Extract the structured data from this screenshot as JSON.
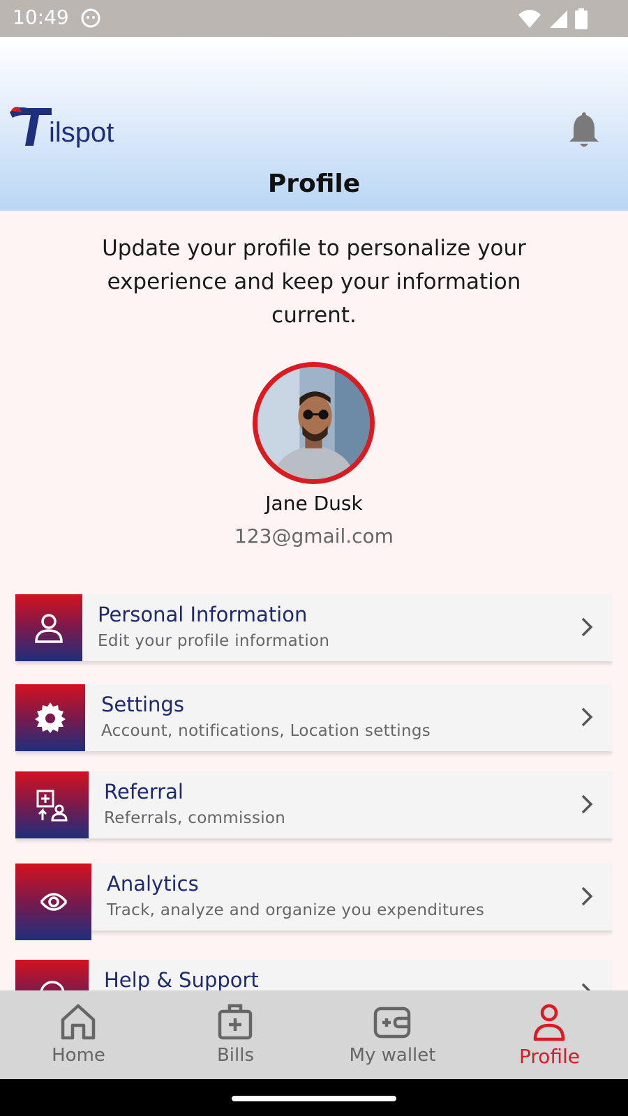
{
  "status_bar": {
    "time": "10:49"
  },
  "header": {
    "brand": "Tilspot",
    "title": "Profile"
  },
  "intro_text": "Update your profile to personalize your experience and keep your information current.",
  "user": {
    "name": "Jane Dusk",
    "email": "123@gmail.com"
  },
  "menu": [
    {
      "title": "Personal Information",
      "subtitle": "Edit your profile information",
      "icon": "user-icon"
    },
    {
      "title": "Settings",
      "subtitle": "Account, notifications, Location settings",
      "icon": "gear-icon"
    },
    {
      "title": "Referral",
      "subtitle": "Referrals, commission",
      "icon": "referral-icon"
    },
    {
      "title": "Analytics",
      "subtitle": "Track, analyze and organize you expenditures",
      "icon": "eye-icon"
    },
    {
      "title": "Help & Support",
      "subtitle": "",
      "icon": "help-icon"
    }
  ],
  "bottom_nav": [
    {
      "label": "Home",
      "icon": "home-icon"
    },
    {
      "label": "Bills",
      "icon": "bills-icon"
    },
    {
      "label": "My wallet",
      "icon": "wallet-icon"
    },
    {
      "label": "Profile",
      "icon": "profile-icon",
      "active": true
    }
  ],
  "colors": {
    "accent_red": "#d91b22",
    "navy": "#1d2b6e",
    "header_blue": "#b9d6f4"
  }
}
